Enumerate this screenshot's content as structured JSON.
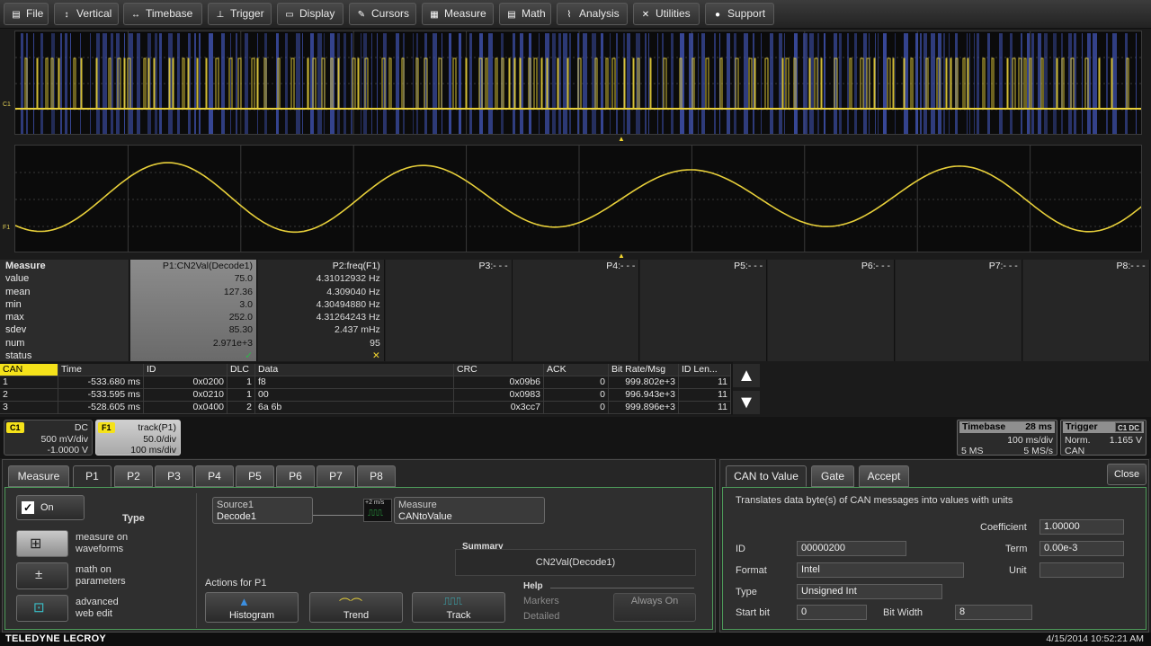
{
  "menu": [
    {
      "label": "File",
      "icon": "folder-icon",
      "glyph": "▤"
    },
    {
      "label": "Vertical",
      "icon": "vertical-arrows-icon",
      "glyph": "↕"
    },
    {
      "label": "Timebase",
      "icon": "horizontal-arrows-icon",
      "glyph": "↔"
    },
    {
      "label": "Trigger",
      "icon": "trigger-icon",
      "glyph": "⊥"
    },
    {
      "label": "Display",
      "icon": "display-icon",
      "glyph": "▭"
    },
    {
      "label": "Cursors",
      "icon": "cursor-icon",
      "glyph": "✎"
    },
    {
      "label": "Measure",
      "icon": "measure-icon",
      "glyph": "▦"
    },
    {
      "label": "Math",
      "icon": "math-icon",
      "glyph": "▤"
    },
    {
      "label": "Analysis",
      "icon": "analysis-icon",
      "glyph": "⌇"
    },
    {
      "label": "Utilities",
      "icon": "tools-icon",
      "glyph": "✕"
    },
    {
      "label": "Support",
      "icon": "info-icon",
      "glyph": "●"
    }
  ],
  "waveforms": {
    "top_tag": "C1",
    "bottom_tag": "F1",
    "colors": {
      "trace": "#e7cf3a",
      "decode": "#3d4fa8",
      "grid": "#3a3a3a"
    }
  },
  "measure": {
    "header": "Measure",
    "rows": [
      "value",
      "mean",
      "min",
      "max",
      "sdev",
      "num",
      "status"
    ],
    "params": [
      {
        "name": "P1:CN2Val(Decode1)",
        "values": [
          "75.0",
          "127.36",
          "3.0",
          "252.0",
          "85.30",
          "2.971e+3",
          "✓"
        ],
        "selected": true
      },
      {
        "name": "P2:freq(F1)",
        "values": [
          "4.31012932 Hz",
          "4.309040 Hz",
          "4.30494880 Hz",
          "4.31264243 Hz",
          "2.437 mHz",
          "95",
          "✕"
        ],
        "selected": false
      },
      {
        "name": "P3:- - -",
        "values": [
          "",
          "",
          "",
          "",
          "",
          "",
          ""
        ],
        "selected": false
      },
      {
        "name": "P4:- - -",
        "values": [
          "",
          "",
          "",
          "",
          "",
          "",
          ""
        ],
        "selected": false
      },
      {
        "name": "P5:- - -",
        "values": [
          "",
          "",
          "",
          "",
          "",
          "",
          ""
        ],
        "selected": false
      },
      {
        "name": "P6:- - -",
        "values": [
          "",
          "",
          "",
          "",
          "",
          "",
          ""
        ],
        "selected": false
      },
      {
        "name": "P7:- - -",
        "values": [
          "",
          "",
          "",
          "",
          "",
          "",
          ""
        ],
        "selected": false
      },
      {
        "name": "P8:- - -",
        "values": [
          "",
          "",
          "",
          "",
          "",
          "",
          ""
        ],
        "selected": false
      }
    ]
  },
  "can_table": {
    "columns": [
      "CAN",
      "Time",
      "ID",
      "DLC",
      "Data",
      "CRC",
      "ACK",
      "Bit Rate/Msg",
      "ID Len..."
    ],
    "rows": [
      [
        "1",
        "-533.680 ms",
        "0x0200",
        "1",
        "f8",
        "0x09b6",
        "0",
        "999.802e+3",
        "11"
      ],
      [
        "2",
        "-533.595 ms",
        "0x0210",
        "1",
        "00",
        "0x0983",
        "0",
        "996.943e+3",
        "11"
      ],
      [
        "3",
        "-528.605 ms",
        "0x0400",
        "2",
        "6a 6b",
        "0x3cc7",
        "0",
        "999.896e+3",
        "11"
      ]
    ],
    "up_label": "▲",
    "down_label": "▼"
  },
  "descriptors": {
    "c1": {
      "tag": "C1",
      "coupling": "DC",
      "vdiv": "500 mV/div",
      "offset": "-1.0000 V"
    },
    "f1": {
      "tag": "F1",
      "func": "track(P1)",
      "vdiv": "50.0/div",
      "tdiv": "100 ms/div"
    },
    "timebase": {
      "title": "Timebase",
      "tval": "28 ms",
      "tdiv": "100 ms/div",
      "samples": "5 MS",
      "rate": "5 MS/s"
    },
    "trigger": {
      "title": "Trigger",
      "badge": "C1 DC",
      "mode": "Norm.",
      "level": "1.165 V",
      "type": "CAN"
    }
  },
  "left_dialog": {
    "tabs": [
      "Measure",
      "P1",
      "P2",
      "P3",
      "P4",
      "P5",
      "P6",
      "P7",
      "P8"
    ],
    "on_label": "On",
    "type_label": "Type",
    "type_options": [
      {
        "line1": "measure on",
        "line2": "waveforms",
        "icon": "waveform-measure-icon"
      },
      {
        "line1": "math on",
        "line2": "parameters",
        "icon": "parameter-math-icon"
      },
      {
        "line1": "advanced",
        "line2": "web edit",
        "icon": "web-edit-icon"
      }
    ],
    "source_label": "Source1",
    "source_value": "Decode1",
    "chip_label": "+2 m/s",
    "measure_label": "Measure",
    "measure_value": "CANtoValue",
    "summary_label": "Summary",
    "summary_value": "CN2Val(Decode1)",
    "actions_label": "Actions for P1",
    "actions": [
      "Histogram",
      "Trend",
      "Track"
    ],
    "help_label": "Help",
    "markers_label": "Markers",
    "always_on_label": "Always On",
    "detailed_label": "Detailed"
  },
  "right_dialog": {
    "tabs": [
      "CAN to Value",
      "Gate",
      "Accept"
    ],
    "close_label": "Close",
    "description": "Translates data byte(s) of CAN messages into values with units",
    "fields": {
      "id_label": "ID",
      "id_value": "00000200",
      "format_label": "Format",
      "format_value": "Intel",
      "type_label": "Type",
      "type_value": "Unsigned Int",
      "startbit_label": "Start bit",
      "startbit_value": "0",
      "bitwidth_label": "Bit Width",
      "bitwidth_value": "8",
      "coef_label": "Coefficient",
      "coef_value": "1.00000",
      "term_label": "Term",
      "term_value": "0.00e-3",
      "unit_label": "Unit",
      "unit_value": ""
    }
  },
  "footer": {
    "brand": "TELEDYNE LECROY",
    "datetime": "4/15/2014 10:52:21 AM"
  }
}
